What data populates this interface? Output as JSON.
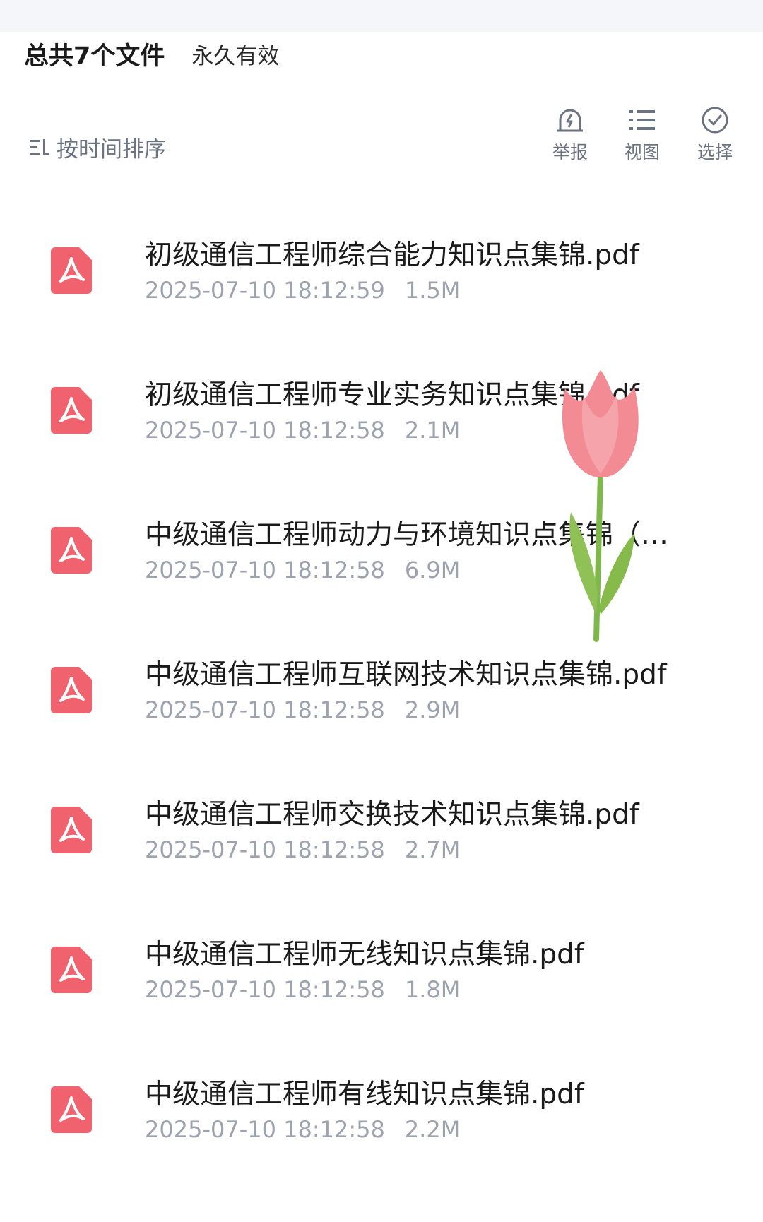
{
  "header": {
    "summary": "总共7个文件",
    "validity": "永久有效"
  },
  "toolbar": {
    "sort_label": "按时间排序",
    "actions": [
      {
        "label": "举报",
        "icon": "report-icon"
      },
      {
        "label": "视图",
        "icon": "list-view-icon"
      },
      {
        "label": "选择",
        "icon": "check-circle-icon"
      }
    ]
  },
  "files": [
    {
      "name": "初级通信工程师综合能力知识点集锦.pdf",
      "time": "2025-07-10 18:12:59",
      "size": "1.5M",
      "icon": "pdf-icon"
    },
    {
      "name": "初级通信工程师专业实务知识点集锦.pdf",
      "time": "2025-07-10 18:12:58",
      "size": "2.1M",
      "icon": "pdf-icon"
    },
    {
      "name": "中级通信工程师动力与环境知识点集锦（…",
      "time": "2025-07-10 18:12:58",
      "size": "6.9M",
      "icon": "pdf-icon"
    },
    {
      "name": "中级通信工程师互联网技术知识点集锦.pdf",
      "time": "2025-07-10 18:12:58",
      "size": "2.9M",
      "icon": "pdf-icon"
    },
    {
      "name": "中级通信工程师交换技术知识点集锦.pdf",
      "time": "2025-07-10 18:12:58",
      "size": "2.7M",
      "icon": "pdf-icon"
    },
    {
      "name": "中级通信工程师无线知识点集锦.pdf",
      "time": "2025-07-10 18:12:58",
      "size": "1.8M",
      "icon": "pdf-icon"
    },
    {
      "name": "中级通信工程师有线知识点集锦.pdf",
      "time": "2025-07-10 18:12:58",
      "size": "2.2M",
      "icon": "pdf-icon"
    }
  ],
  "colors": {
    "pdf_red": "#f0626d",
    "muted_text": "#9ca3af",
    "icon_gray": "#6b7280"
  }
}
